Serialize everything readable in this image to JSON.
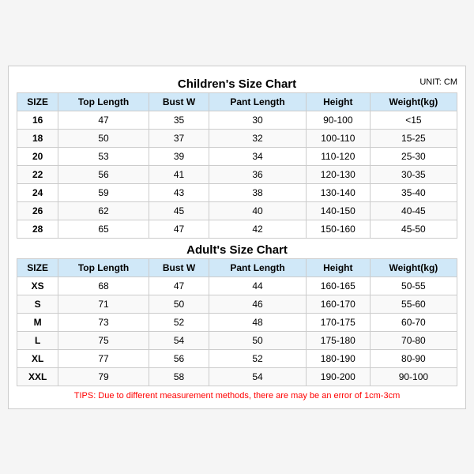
{
  "childrenChart": {
    "title": "Children's Size Chart",
    "unit": "UNIT: CM",
    "headers": [
      "SIZE",
      "Top Length",
      "Bust W",
      "Pant Length",
      "Height",
      "Weight(kg)"
    ],
    "rows": [
      [
        "16",
        "47",
        "35",
        "30",
        "90-100",
        "<15"
      ],
      [
        "18",
        "50",
        "37",
        "32",
        "100-110",
        "15-25"
      ],
      [
        "20",
        "53",
        "39",
        "34",
        "110-120",
        "25-30"
      ],
      [
        "22",
        "56",
        "41",
        "36",
        "120-130",
        "30-35"
      ],
      [
        "24",
        "59",
        "43",
        "38",
        "130-140",
        "35-40"
      ],
      [
        "26",
        "62",
        "45",
        "40",
        "140-150",
        "40-45"
      ],
      [
        "28",
        "65",
        "47",
        "42",
        "150-160",
        "45-50"
      ]
    ]
  },
  "adultChart": {
    "title": "Adult's Size Chart",
    "headers": [
      "SIZE",
      "Top Length",
      "Bust W",
      "Pant Length",
      "Height",
      "Weight(kg)"
    ],
    "rows": [
      [
        "XS",
        "68",
        "47",
        "44",
        "160-165",
        "50-55"
      ],
      [
        "S",
        "71",
        "50",
        "46",
        "160-170",
        "55-60"
      ],
      [
        "M",
        "73",
        "52",
        "48",
        "170-175",
        "60-70"
      ],
      [
        "L",
        "75",
        "54",
        "50",
        "175-180",
        "70-80"
      ],
      [
        "XL",
        "77",
        "56",
        "52",
        "180-190",
        "80-90"
      ],
      [
        "XXL",
        "79",
        "58",
        "54",
        "190-200",
        "90-100"
      ]
    ]
  },
  "tips": "TIPS: Due to different measurement methods, there are may be an error of 1cm-3cm"
}
